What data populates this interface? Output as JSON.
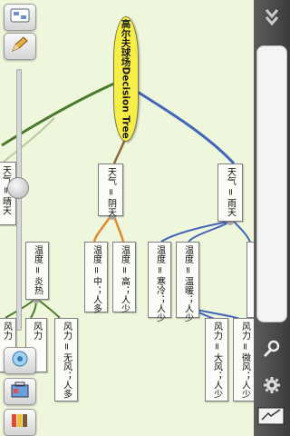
{
  "tree": {
    "root": "高尔夫球场Decision Tree",
    "nodes": [
      "天气 = 阴天",
      "天气 = 雨天",
      "天气 = 晴天",
      "温度 = 中；人多",
      "温度 = 高；人少",
      "温度 = 寒冷；人少",
      "温度 = 温暖；人少",
      "温度 = 炎热",
      "风力 = 无风；人多",
      "风力 = 大风；人少",
      "风力 = 微风；人少",
      "风力",
      "风力"
    ]
  },
  "colors": {
    "canvas_bg": "#eef6dc",
    "root_fill": "#f6ee48",
    "branch_green": "#4a7a2a",
    "branch_blue": "#4466b8",
    "branch_orange": "#e08a30",
    "panel_dark": "#4a4a4a"
  },
  "toolbar": {
    "left_icons": [
      "edit-node-icon",
      "pencil-icon",
      "bubble-icon",
      "toolbox-icon",
      "palette-icon"
    ],
    "zoom_level_fraction": 0.45,
    "right_icons": [
      "collapse-arrows-icon",
      "search-icon",
      "gear-icon",
      "presentation-icon"
    ]
  }
}
